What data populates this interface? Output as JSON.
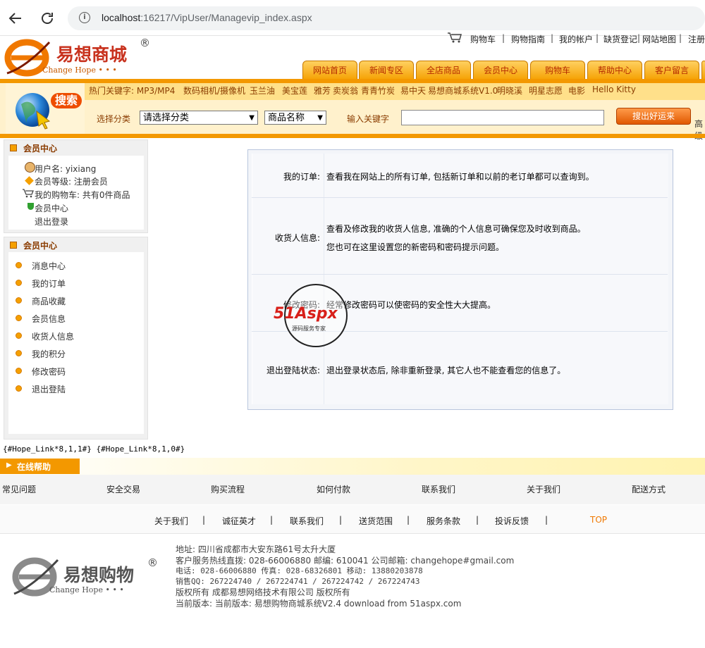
{
  "browser": {
    "url_host": "localhost",
    "url_rest": ":16217/VipUser/Managevip_index.aspx",
    "back_icon": "arrow-left-icon",
    "reload_icon": "reload-icon",
    "info_icon": "info-icon"
  },
  "logo": {
    "cn": "易想商城",
    "en": "Change Hope • • •",
    "reg": "®"
  },
  "top_links": [
    "购物车",
    "购物指南",
    "我的帐户",
    "缺货登记",
    "网站地图",
    "注册"
  ],
  "nav_tabs": [
    "网站首页",
    "新闻专区",
    "全店商品",
    "会员中心",
    "购物车",
    "帮助中心",
    "客户留言"
  ],
  "search": {
    "hot_keywords": [
      "热门关键字: MP3/MP4",
      "数码相机/摄像机",
      "玉兰油",
      "美宝莲",
      "雅芳",
      "卖炭翁",
      "青青竹炭",
      "易中天",
      "易想商城系统V1.0",
      "明晓溪",
      "明星志愿",
      "电影",
      "Hello Kitty"
    ],
    "badge": "搜索",
    "category_label": "选择分类",
    "category_value": "请选择分类",
    "type_value": "商品名称",
    "keyword_label": "输入关键字",
    "keyword_value": "",
    "button": "搜出好运来",
    "advanced": "高级"
  },
  "member_panel": {
    "title": "会员中心",
    "username": "用户名: yixiang",
    "level": "会员等级: 注册会员",
    "cart": "我的购物车: 共有0件商品",
    "center": "会员中心",
    "logout": "退出登录"
  },
  "menu_panel": {
    "title": "会员中心",
    "items": [
      "消息中心",
      "我的订单",
      "商品收藏",
      "会员信息",
      "收货人信息",
      "我的积分",
      "修改密码",
      "退出登陆"
    ]
  },
  "rows": [
    {
      "label": "我的订单:",
      "lines": [
        "查看我在网站上的所有订单, 包括新订单和以前的老订单都可以查询到。"
      ]
    },
    {
      "label": "收货人信息:",
      "lines": [
        "查看及修改我的收货人信息, 准确的个人信息可确保您及时收到商品。",
        "您也可在这里设置您的新密码和密码提示问题。"
      ]
    },
    {
      "label": "修改密码:",
      "lines": [
        "经常修改密码可以使密码的安全性大大提高。"
      ]
    },
    {
      "label": "退出登陆状态:",
      "lines": [
        "退出登录状态后, 除非重新登录, 其它人也不能查看您的信息了。"
      ]
    }
  ],
  "watermark": {
    "main": "51Aspx",
    "sub": "源码服务专家"
  },
  "placeholder_text": "{#Hope_Link*8,1,1#} {#Hope_Link*8,1,0#}",
  "help": {
    "title": "在线帮助",
    "links": [
      "常见问题",
      "安全交易",
      "购买流程",
      "如何付款",
      "联系我们",
      "关于我们",
      "配送方式"
    ]
  },
  "footer_links": [
    "关于我们",
    "诚征英才",
    "联系我们",
    "送货范围",
    "服务条款",
    "投诉反馈"
  ],
  "top_link": "TOP",
  "footer_logo": {
    "cn": "易想购物",
    "en": "Change Hope • • •",
    "reg": "®"
  },
  "info": [
    "地址: 四川省成都市大安东路61号太升大厦",
    "客户服务热线直拨: 028-66006880 邮编: 610041 公司邮箱: changehope#gmail.com",
    "电话: 028-66006880 传真: 028-68326801 移动: 13880203878",
    "销售QQ: 267224740 / 267224741 / 267224742 / 267224743",
    "版权所有 成都易想网络技术有限公司 版权所有",
    "当前版本: 当前版本: 易想购物商城系统V2.4 download from 51aspx.com"
  ]
}
